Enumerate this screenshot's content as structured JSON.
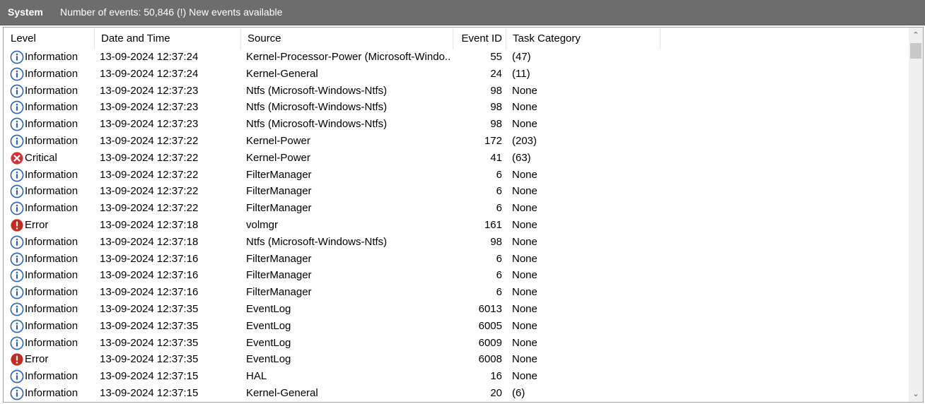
{
  "titlebar": {
    "log_name": "System",
    "event_info": "Number of events: 50,846 (!) New events available"
  },
  "columns": {
    "level": "Level",
    "date": "Date and Time",
    "source": "Source",
    "event_id": "Event ID",
    "task": "Task Category"
  },
  "rows": [
    {
      "level": "Information",
      "date": "13-09-2024 12:37:24",
      "source": "Kernel-Processor-Power (Microsoft-Windo...",
      "event_id": "55",
      "task": "(47)"
    },
    {
      "level": "Information",
      "date": "13-09-2024 12:37:24",
      "source": "Kernel-General",
      "event_id": "24",
      "task": "(11)"
    },
    {
      "level": "Information",
      "date": "13-09-2024 12:37:23",
      "source": "Ntfs (Microsoft-Windows-Ntfs)",
      "event_id": "98",
      "task": "None"
    },
    {
      "level": "Information",
      "date": "13-09-2024 12:37:23",
      "source": "Ntfs (Microsoft-Windows-Ntfs)",
      "event_id": "98",
      "task": "None"
    },
    {
      "level": "Information",
      "date": "13-09-2024 12:37:23",
      "source": "Ntfs (Microsoft-Windows-Ntfs)",
      "event_id": "98",
      "task": "None"
    },
    {
      "level": "Information",
      "date": "13-09-2024 12:37:22",
      "source": "Kernel-Power",
      "event_id": "172",
      "task": "(203)"
    },
    {
      "level": "Critical",
      "date": "13-09-2024 12:37:22",
      "source": "Kernel-Power",
      "event_id": "41",
      "task": "(63)"
    },
    {
      "level": "Information",
      "date": "13-09-2024 12:37:22",
      "source": "FilterManager",
      "event_id": "6",
      "task": "None"
    },
    {
      "level": "Information",
      "date": "13-09-2024 12:37:22",
      "source": "FilterManager",
      "event_id": "6",
      "task": "None"
    },
    {
      "level": "Information",
      "date": "13-09-2024 12:37:22",
      "source": "FilterManager",
      "event_id": "6",
      "task": "None"
    },
    {
      "level": "Error",
      "date": "13-09-2024 12:37:18",
      "source": "volmgr",
      "event_id": "161",
      "task": "None"
    },
    {
      "level": "Information",
      "date": "13-09-2024 12:37:18",
      "source": "Ntfs (Microsoft-Windows-Ntfs)",
      "event_id": "98",
      "task": "None"
    },
    {
      "level": "Information",
      "date": "13-09-2024 12:37:16",
      "source": "FilterManager",
      "event_id": "6",
      "task": "None"
    },
    {
      "level": "Information",
      "date": "13-09-2024 12:37:16",
      "source": "FilterManager",
      "event_id": "6",
      "task": "None"
    },
    {
      "level": "Information",
      "date": "13-09-2024 12:37:16",
      "source": "FilterManager",
      "event_id": "6",
      "task": "None"
    },
    {
      "level": "Information",
      "date": "13-09-2024 12:37:35",
      "source": "EventLog",
      "event_id": "6013",
      "task": "None"
    },
    {
      "level": "Information",
      "date": "13-09-2024 12:37:35",
      "source": "EventLog",
      "event_id": "6005",
      "task": "None"
    },
    {
      "level": "Information",
      "date": "13-09-2024 12:37:35",
      "source": "EventLog",
      "event_id": "6009",
      "task": "None"
    },
    {
      "level": "Error",
      "date": "13-09-2024 12:37:35",
      "source": "EventLog",
      "event_id": "6008",
      "task": "None"
    },
    {
      "level": "Information",
      "date": "13-09-2024 12:37:15",
      "source": "HAL",
      "event_id": "16",
      "task": "None"
    },
    {
      "level": "Information",
      "date": "13-09-2024 12:37:15",
      "source": "Kernel-General",
      "event_id": "20",
      "task": "(6)"
    }
  ],
  "icons": {
    "Information": "info-icon",
    "Critical": "critical-icon",
    "Error": "error-icon"
  },
  "colors": {
    "titlebar": "#6d6d6d",
    "info_blue": "#2a63b8",
    "critical_red": "#d13438",
    "error_red": "#c42b1c"
  }
}
